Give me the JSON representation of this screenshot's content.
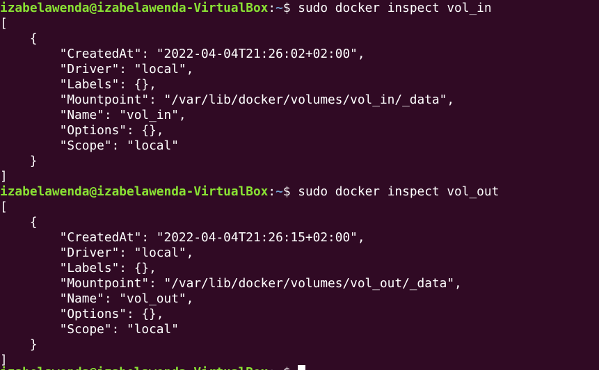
{
  "prompt": {
    "user_host": "izabelawenda@izabelawenda-VirtualBox",
    "separator": ":",
    "path": "~",
    "symbol": "$ "
  },
  "commands": [
    {
      "command": "sudo docker inspect vol_in",
      "output": [
        "[",
        "    {",
        "        \"CreatedAt\": \"2022-04-04T21:26:02+02:00\",",
        "        \"Driver\": \"local\",",
        "        \"Labels\": {},",
        "        \"Mountpoint\": \"/var/lib/docker/volumes/vol_in/_data\",",
        "        \"Name\": \"vol_in\",",
        "        \"Options\": {},",
        "        \"Scope\": \"local\"",
        "    }",
        "]"
      ]
    },
    {
      "command": "sudo docker inspect vol_out",
      "output": [
        "[",
        "    {",
        "        \"CreatedAt\": \"2022-04-04T21:26:15+02:00\",",
        "        \"Driver\": \"local\",",
        "        \"Labels\": {},",
        "        \"Mountpoint\": \"/var/lib/docker/volumes/vol_out/_data\",",
        "        \"Name\": \"vol_out\",",
        "        \"Options\": {},",
        "        \"Scope\": \"local\"",
        "    }",
        "]"
      ]
    }
  ],
  "current_input": "",
  "colors": {
    "background": "#300a24",
    "text": "#ffffff",
    "user_host": "#8ae234",
    "path": "#729fcf",
    "cursor": "#ffffff"
  }
}
